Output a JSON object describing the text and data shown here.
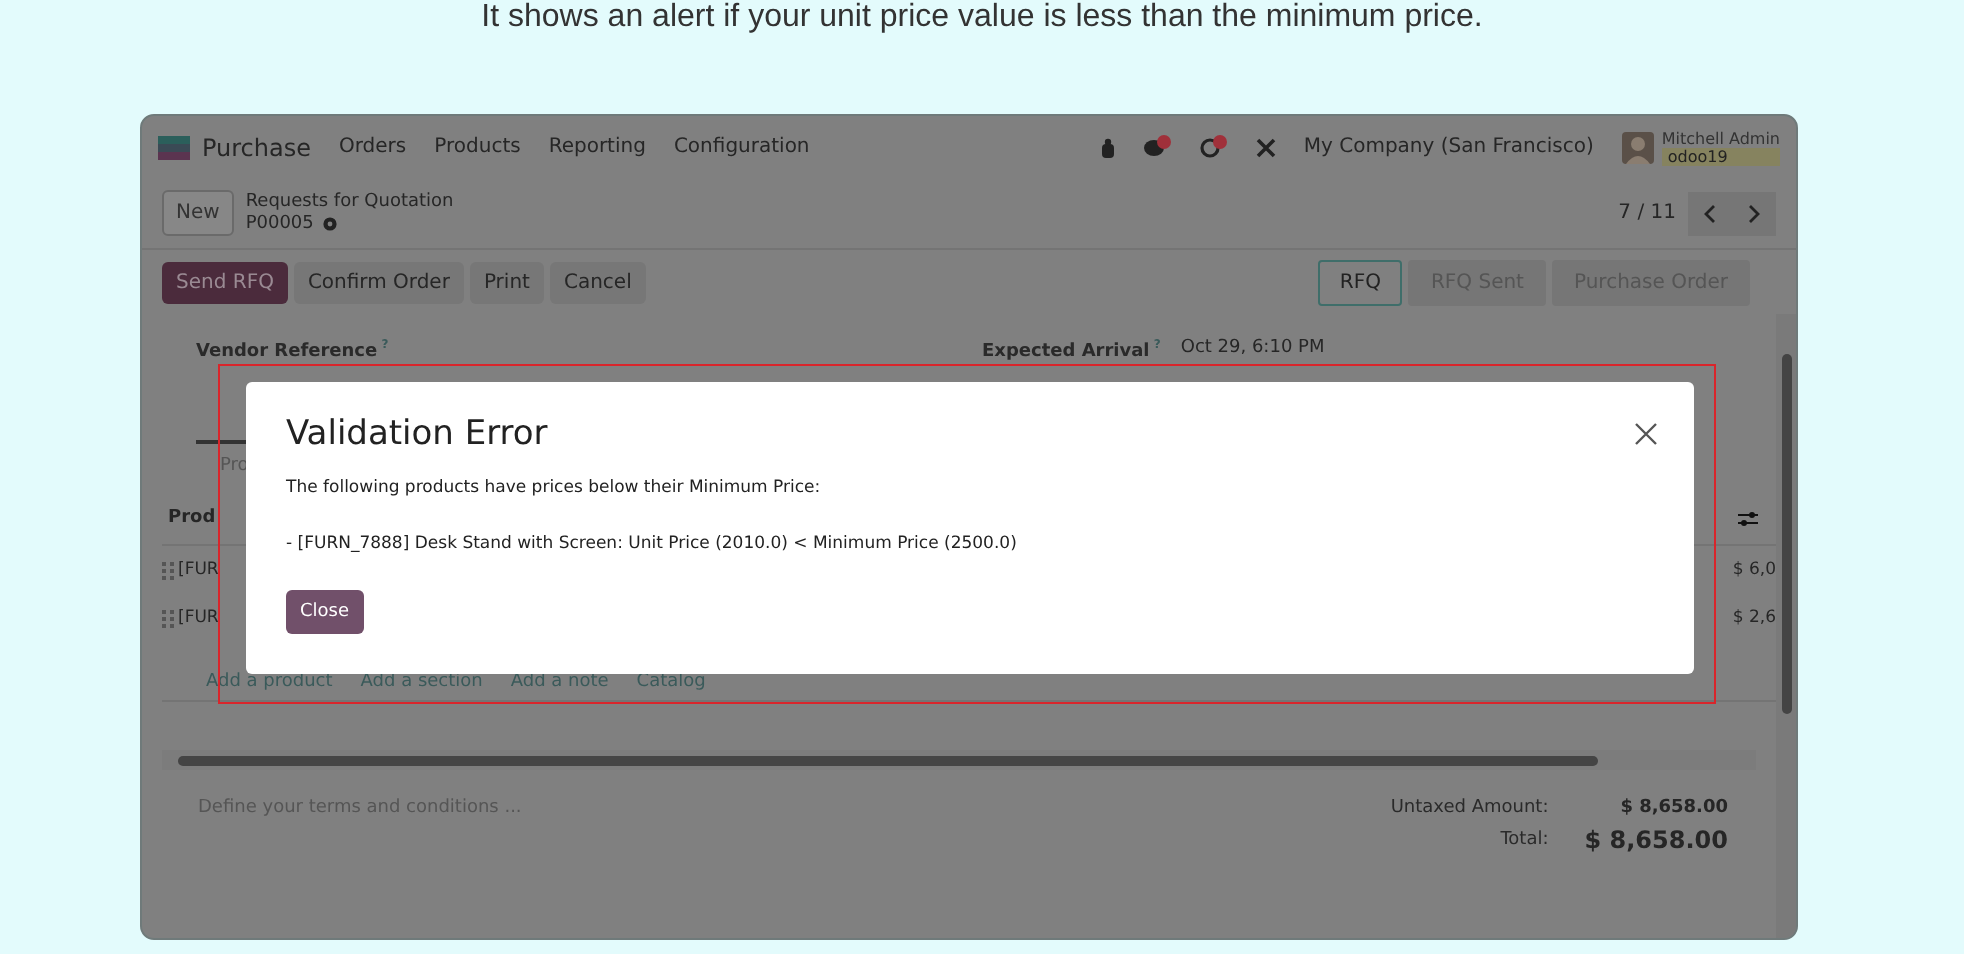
{
  "caption": "It shows an alert if your unit price value is less than the minimum price.",
  "navbar": {
    "app": "Purchase",
    "menus": [
      "Orders",
      "Products",
      "Reporting",
      "Configuration"
    ],
    "company": "My Company (San Francisco)",
    "user": "Mitchell Admin",
    "database": "odoo19"
  },
  "control_panel": {
    "new_button": "New",
    "breadcrumb": "Requests for Quotation",
    "record": "P00005",
    "pager": "7 / 11"
  },
  "actions": [
    {
      "label": "Send RFQ",
      "kind": "primary"
    },
    {
      "label": "Confirm Order",
      "kind": "secondary"
    },
    {
      "label": "Print",
      "kind": "secondary"
    },
    {
      "label": "Cancel",
      "kind": "secondary"
    }
  ],
  "stages": [
    {
      "label": "RFQ",
      "selected": true
    },
    {
      "label": "RFQ Sent",
      "selected": false
    },
    {
      "label": "Purchase Order",
      "selected": false
    }
  ],
  "fields": [
    {
      "label": "Vendor Reference",
      "help": "?"
    },
    {
      "label": "Expected Arrival",
      "help": "?",
      "value": "Oct 29, 6:10 PM"
    }
  ],
  "tab": "Pro",
  "column": "Prod",
  "lines": [
    {
      "product": "[FUR",
      "subtotal": "$ 6,0"
    },
    {
      "product": "[FUR",
      "subtotal": "$ 2,6"
    }
  ],
  "add_links": [
    "Add a product",
    "Add a section",
    "Add a note",
    "Catalog"
  ],
  "terms_placeholder": "Define your terms and conditions ...",
  "totals": [
    {
      "label": "Untaxed Amount:",
      "value": "$ 8,658.00",
      "kind": "subtotal"
    },
    {
      "label": "Total:",
      "value": "$ 8,658.00",
      "kind": "grand"
    }
  ],
  "dialog": {
    "title": "Validation Error",
    "message": "The following products have prices below their Minimum Price:",
    "detail": "- [FURN_7888] Desk Stand with Screen: Unit Price (2010.0) < Minimum Price (2500.0)",
    "close_button": "Close"
  }
}
